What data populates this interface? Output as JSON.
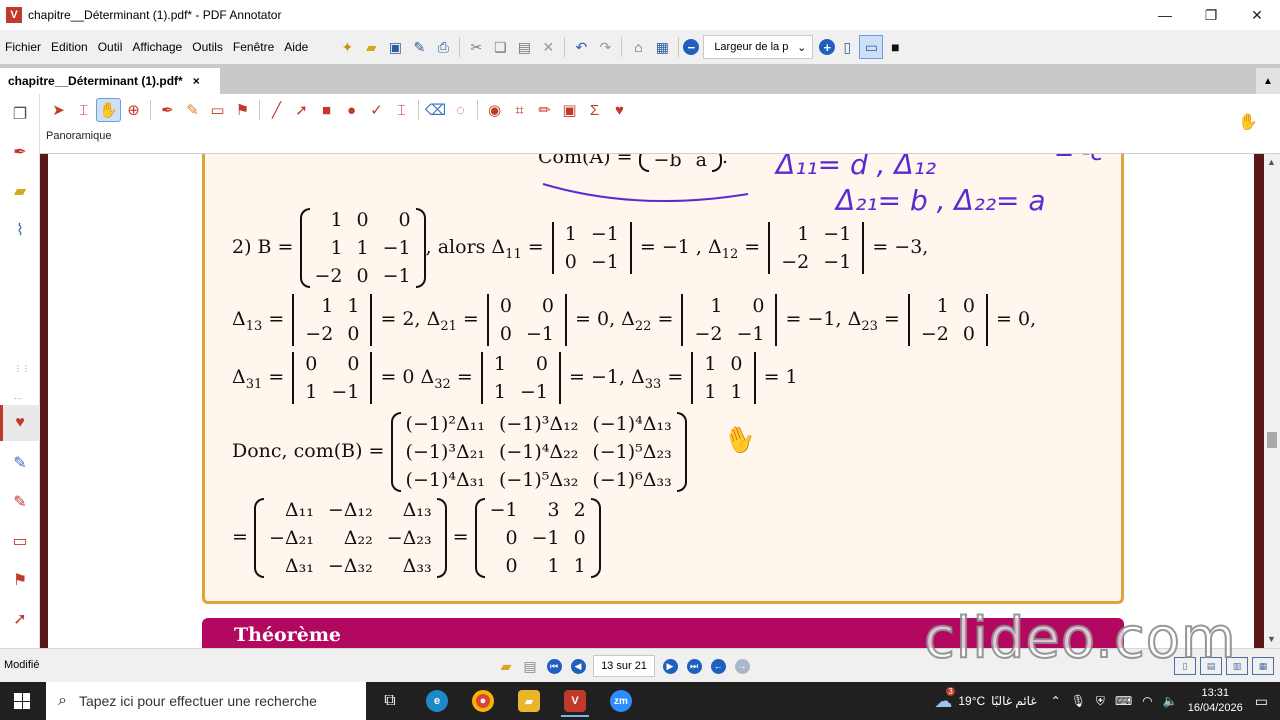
{
  "window": {
    "title": "chapitre__Déterminant (1).pdf* - PDF Annotator",
    "logo_letter": "V",
    "minimize": "—",
    "maximize": "❐",
    "close": "✕"
  },
  "menu": [
    "Fichier",
    "Edition",
    "Outil",
    "Affichage",
    "Outils",
    "Fenêtre",
    "Aide"
  ],
  "toolbar": {
    "zoom_value": "Largeur de la p",
    "zoom_caret": "⌄"
  },
  "tab": {
    "label": "chapitre__Déterminant (1).pdf*",
    "close": "×",
    "scroll": "▲"
  },
  "annotation_toolbar": {
    "mode_label": "Panoramique"
  },
  "document": {
    "com_a": "Com(A) =",
    "com_a_row": [
      "−b",
      "a"
    ],
    "item2_prefix": "2) B =",
    "B": [
      [
        "1",
        "0",
        "0"
      ],
      [
        "1",
        "1",
        "−1"
      ],
      [
        "−2",
        "0",
        "−1"
      ]
    ],
    "alors": ", alors Δ",
    "d11_sub": "11",
    "d11_mat": [
      [
        "1",
        "−1"
      ],
      [
        "0",
        "−1"
      ]
    ],
    "d11_val": "= −1 , Δ",
    "d12_sub": "12",
    "d12_mat": [
      [
        "1",
        "−1"
      ],
      [
        "−2",
        "−1"
      ]
    ],
    "d12_val": "= −3,",
    "d13_label": "Δ",
    "d13_sub": "13",
    "d13_mat": [
      [
        "1",
        "1"
      ],
      [
        "−2",
        "0"
      ]
    ],
    "d13_val": "= 2, Δ",
    "d21_sub": "21",
    "d21_mat": [
      [
        "0",
        "0"
      ],
      [
        "0",
        "−1"
      ]
    ],
    "d21_val": "= 0, Δ",
    "d22_sub": "22",
    "d22_mat": [
      [
        "1",
        "0"
      ],
      [
        "−2",
        "−1"
      ]
    ],
    "d22_val": "= −1, Δ",
    "d23_sub": "23",
    "d23_mat": [
      [
        "1",
        "0"
      ],
      [
        "−2",
        "0"
      ]
    ],
    "d23_val": "= 0,",
    "d31_label": "Δ",
    "d31_sub": "31",
    "d31_mat": [
      [
        "0",
        "0"
      ],
      [
        "1",
        "−1"
      ]
    ],
    "d31_val": "= 0 Δ",
    "d32_sub": "32",
    "d32_mat": [
      [
        "1",
        "0"
      ],
      [
        "1",
        "−1"
      ]
    ],
    "d32_val": "= −1, Δ",
    "d33_sub": "33",
    "d33_mat": [
      [
        "1",
        "0"
      ],
      [
        "1",
        "1"
      ]
    ],
    "d33_val": "= 1",
    "donc": "Donc, com(B) =",
    "cof_mat": [
      [
        "(−1)²Δ₁₁",
        "(−1)³Δ₁₂",
        "(−1)⁴Δ₁₃"
      ],
      [
        "(−1)³Δ₂₁",
        "(−1)⁴Δ₂₂",
        "(−1)⁵Δ₂₃"
      ],
      [
        "(−1)⁴Δ₃₁",
        "(−1)⁵Δ₃₂",
        "(−1)⁶Δ₃₃"
      ]
    ],
    "eq1": "=",
    "sign_mat": [
      [
        "Δ₁₁",
        "−Δ₁₂",
        "Δ₁₃"
      ],
      [
        "−Δ₂₁",
        "Δ₂₂",
        "−Δ₂₃"
      ],
      [
        "Δ₃₁",
        "−Δ₃₂",
        "Δ₃₃"
      ]
    ],
    "eq2": "=",
    "result_mat": [
      [
        "−1",
        "3",
        "2"
      ],
      [
        "0",
        "−1",
        "0"
      ],
      [
        "0",
        "1",
        "1"
      ]
    ],
    "theoreme": "Théorème"
  },
  "handwriting": {
    "line1": "Δ₁₁= d , Δ₁₂",
    "line2": "Δ₂₁= b , Δ₂₂= a",
    "corner": "= -c"
  },
  "statusbar": {
    "status": "Modifié",
    "page_indicator": "13 sur 21",
    "watermark": "clideo.com"
  },
  "taskbar": {
    "search_placeholder": "Tapez ici pour effectuer une recherche",
    "weather": "19°C",
    "weather_text": "غائم غالبًا",
    "weather_badge": "3",
    "time": "13:31",
    "date": "16/04/2026"
  },
  "colors": {
    "accent_red": "#c0392b",
    "frame_orange": "#e2a23a",
    "theorem_magenta": "#b3085f",
    "ink_purple": "#5a2bd0",
    "nav_blue": "#1f5fbf"
  }
}
